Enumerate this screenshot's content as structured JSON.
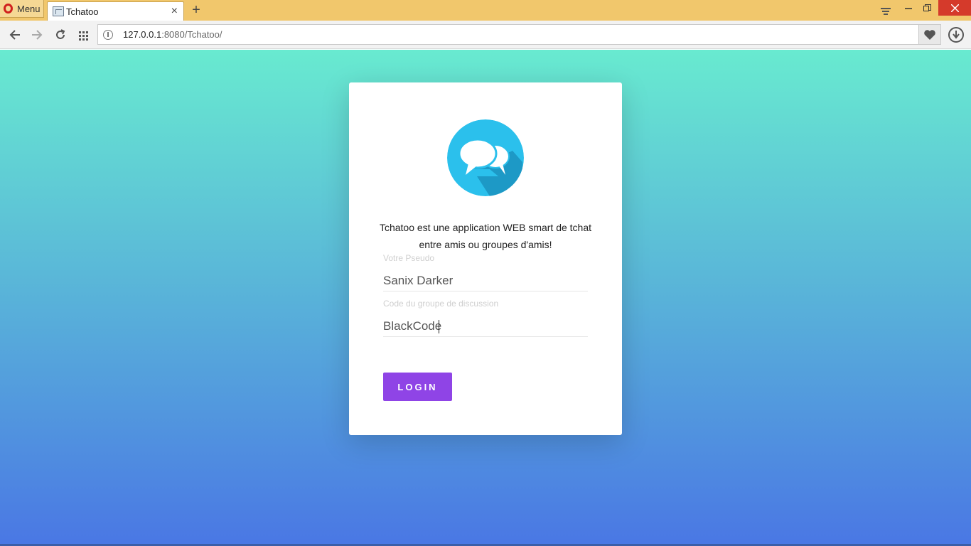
{
  "browser": {
    "menu_label": "Menu",
    "tab_title": "Tchatoo",
    "new_tab_symbol": "+",
    "close_tab_symbol": "×",
    "url_host": "127.0.0.1",
    "url_rest": ":8080/Tchatoo/"
  },
  "login": {
    "description": "Tchatoo est une application WEB smart de tchat entre amis ou groupes d'amis!",
    "pseudo_label": "Votre Pseudo",
    "pseudo_value": "Sanix Darker",
    "code_label": "Code du groupe de discussion",
    "code_value": "BlackCode",
    "login_button": "LOGIN"
  },
  "colors": {
    "gradient_top": "#68ead0",
    "gradient_bottom": "#4a77e4",
    "button": "#8f44e6",
    "logo_circle": "#2bc0ec"
  }
}
